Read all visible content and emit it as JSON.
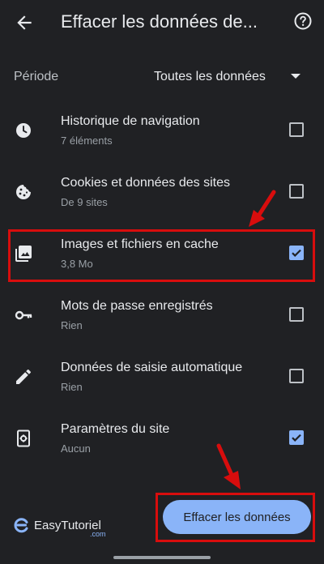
{
  "header": {
    "title": "Effacer les données de..."
  },
  "period": {
    "label": "Période",
    "value": "Toutes les données"
  },
  "items": [
    {
      "label": "Historique de navigation",
      "sub": "7 éléments",
      "checked": false
    },
    {
      "label": "Cookies et données des sites",
      "sub": "De 9 sites",
      "checked": false
    },
    {
      "label": "Images et fichiers en cache",
      "sub": "3,8 Mo",
      "checked": true
    },
    {
      "label": "Mots de passe enregistrés",
      "sub": "Rien",
      "checked": false
    },
    {
      "label": "Données de saisie automatique",
      "sub": "Rien",
      "checked": false
    },
    {
      "label": "Paramètres du site",
      "sub": "Aucun",
      "checked": true
    }
  ],
  "footer": {
    "clear_button": "Effacer les données",
    "logo_text": "EasyTutoriel",
    "logo_suffix": ".com"
  },
  "colors": {
    "background": "#202124",
    "accent": "#8ab4f8",
    "annotation": "#d80d0d"
  }
}
